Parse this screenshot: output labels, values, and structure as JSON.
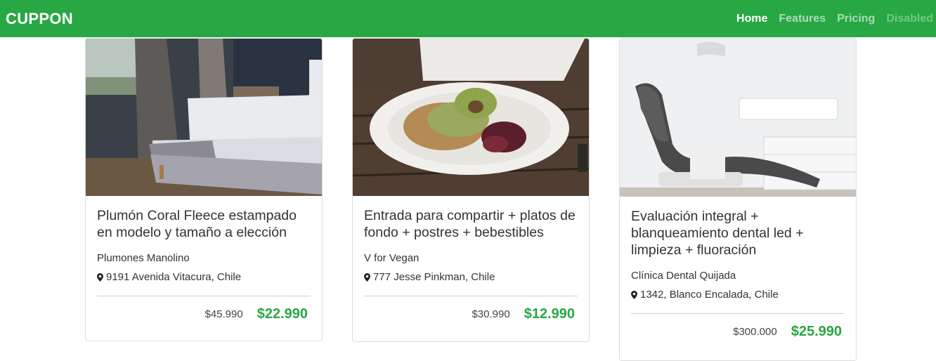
{
  "navbar": {
    "brand": "CUPPON",
    "links": [
      "Home",
      "Features",
      "Pricing",
      "Disabled"
    ]
  },
  "colors": {
    "brand": "#28a745",
    "price": "#28a745"
  },
  "icons": {
    "location": "map-marker-icon"
  },
  "cards": [
    {
      "image": "bedroom-photo",
      "title": "Plumón Coral Fleece estampado en modelo y tamaño a elección",
      "merchant": "Plumones Manolino",
      "address": "9191 Avenida Vitacura, Chile",
      "old_price": "$45.990",
      "new_price": "$22.990"
    },
    {
      "image": "vegan-food-photo",
      "title": "Entrada para compartir + platos de fondo + postres + bebestibles",
      "merchant": "V for Vegan",
      "address": "777 Jesse Pinkman, Chile",
      "old_price": "$30.990",
      "new_price": "$12.990"
    },
    {
      "image": "dental-chair-photo",
      "title": "Evaluación integral + blanqueamiento dental led + limpieza + fluoración",
      "merchant": "Clínica Dental Quijada",
      "address": "1342, Blanco Encalada, Chile",
      "old_price": "$300.000",
      "new_price": "$25.990"
    }
  ]
}
